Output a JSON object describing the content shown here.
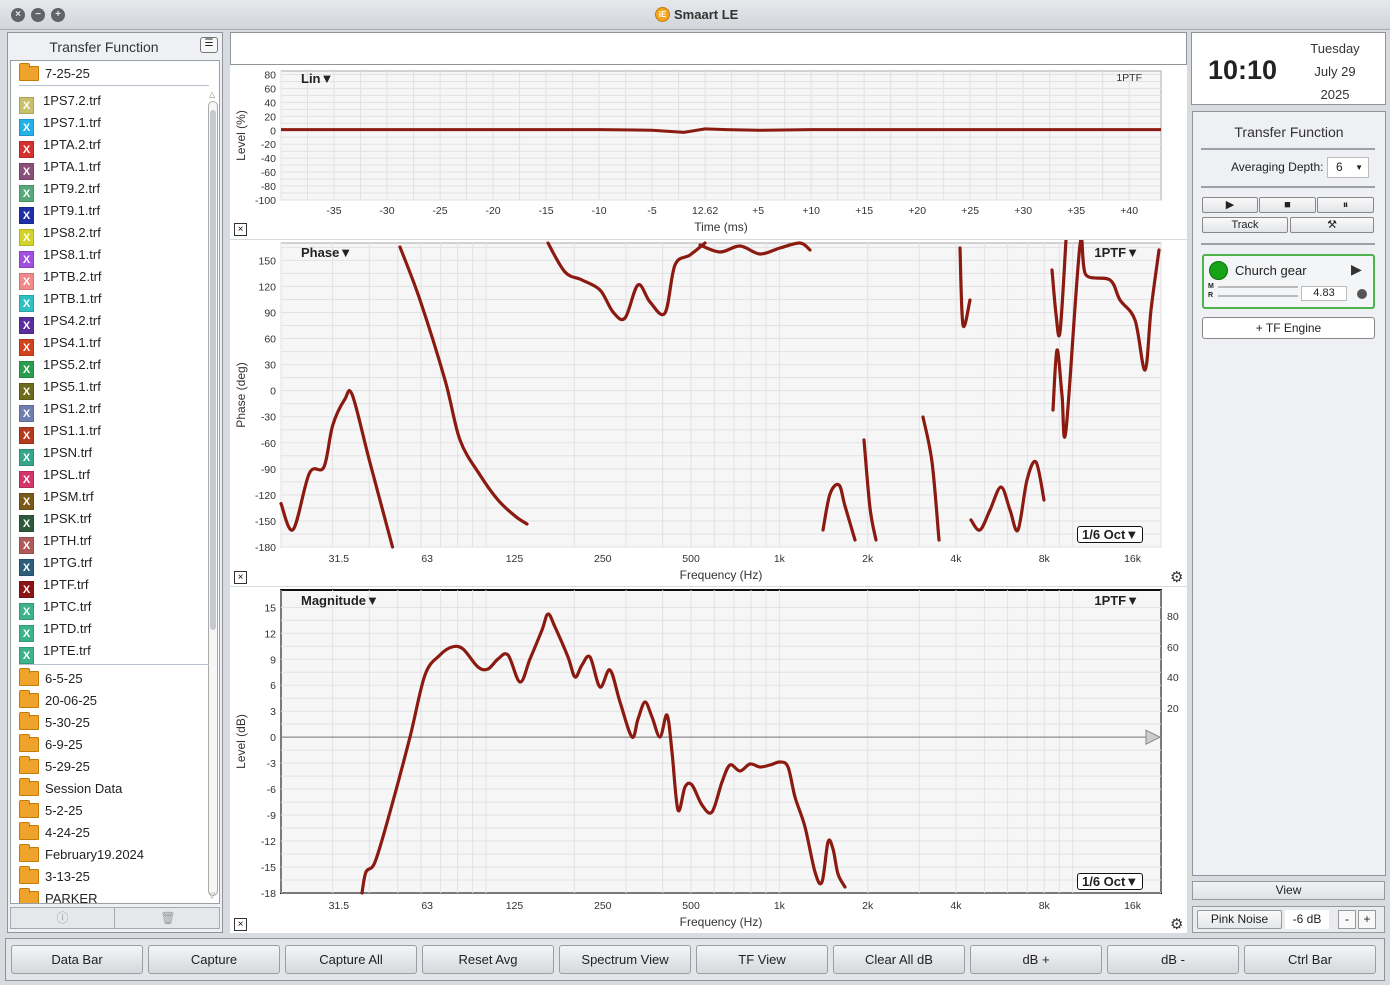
{
  "window": {
    "title": "Smaart LE",
    "logo_text": "iE"
  },
  "sidebar": {
    "title": "Transfer Function",
    "current_folder": "7-25-25",
    "files": [
      {
        "name": "1PS7.2.trf",
        "color": "#c8c06a"
      },
      {
        "name": "1PS7.1.trf",
        "color": "#23b1e8"
      },
      {
        "name": "1PTA.2.trf",
        "color": "#d63030"
      },
      {
        "name": "1PTA.1.trf",
        "color": "#8a4f7a"
      },
      {
        "name": "1PT9.2.trf",
        "color": "#56a97a"
      },
      {
        "name": "1PT9.1.trf",
        "color": "#1f2fa6"
      },
      {
        "name": "1PS8.2.trf",
        "color": "#d3d32a"
      },
      {
        "name": "1PS8.1.trf",
        "color": "#a24fe0"
      },
      {
        "name": "1PTB.2.trf",
        "color": "#f28a8a"
      },
      {
        "name": "1PTB.1.trf",
        "color": "#2fc1c1"
      },
      {
        "name": "1PS4.2.trf",
        "color": "#5a2e9c"
      },
      {
        "name": "1PS4.1.trf",
        "color": "#d2421c"
      },
      {
        "name": "1PS5.2.trf",
        "color": "#2a9e4e"
      },
      {
        "name": "1PS5.1.trf",
        "color": "#6e6b1a"
      },
      {
        "name": "1PS1.2.trf",
        "color": "#6f7fb0"
      },
      {
        "name": "1PS1.1.trf",
        "color": "#b33a1c"
      },
      {
        "name": "1PSN.trf",
        "color": "#36a58c"
      },
      {
        "name": "1PSL.trf",
        "color": "#d3346b"
      },
      {
        "name": "1PSM.trf",
        "color": "#7a5a1a"
      },
      {
        "name": "1PSK.trf",
        "color": "#2e5a3c"
      },
      {
        "name": "1PTH.trf",
        "color": "#b05a5a"
      },
      {
        "name": "1PTG.trf",
        "color": "#2b5f7c"
      },
      {
        "name": "1PTF.trf",
        "color": "#8c1414"
      },
      {
        "name": "1PTC.trf",
        "color": "#3cb389"
      },
      {
        "name": "1PTD.trf",
        "color": "#3cb389"
      },
      {
        "name": "1PTE.trf",
        "color": "#3cb389"
      }
    ],
    "folders": [
      "6-5-25",
      "20-06-25",
      "5-30-25",
      "6-9-25",
      "5-29-25",
      "Session Data",
      "5-2-25",
      "4-24-25",
      "February19.2024",
      "3-13-25",
      "PARKER"
    ],
    "footer_info": "ⓘ",
    "footer_trash": "🗑"
  },
  "clock": {
    "time": "10:10",
    "weekday": "Tuesday",
    "date": "July 29",
    "year": "2025"
  },
  "right_panel": {
    "title": "Transfer Function",
    "averaging_label": "Averaging Depth:",
    "averaging_value": "6",
    "play": "▶",
    "stop": "■",
    "pause": "⏸",
    "track": "Track",
    "tools": "⚒",
    "engine_name": "Church gear",
    "engine_m": "M",
    "engine_r": "R",
    "engine_value": "4.83",
    "add_engine": "+ TF Engine",
    "view": "View",
    "pink_noise": "Pink Noise",
    "noise_level": "-6 dB",
    "minus": "-",
    "plus": "+"
  },
  "plots": {
    "impulse": {
      "title": "Lin▼",
      "tag": "1PTF",
      "ylabel": "Level (%)",
      "xlabel": "Time (ms)",
      "yticks": [
        "80",
        "60",
        "40",
        "20",
        "0",
        "-20",
        "-40",
        "-60",
        "-80",
        "-100"
      ],
      "xticks": [
        "-35",
        "-30",
        "-25",
        "-20",
        "-15",
        "-10",
        "-5",
        "12.62",
        "+5",
        "+10",
        "+15",
        "+20",
        "+25",
        "+30",
        "+35",
        "+40"
      ]
    },
    "phase": {
      "title": "Phase▼",
      "tag": "1PTF▼",
      "ylabel": "Phase (deg)",
      "xlabel": "Frequency (Hz)",
      "yticks": [
        "150",
        "120",
        "90",
        "60",
        "30",
        "0",
        "-30",
        "-60",
        "-90",
        "-120",
        "-150",
        "-180"
      ],
      "xticks": [
        "31.5",
        "63",
        "125",
        "250",
        "500",
        "1k",
        "2k",
        "4k",
        "8k",
        "16k"
      ],
      "smoothing": "1/6 Oct▼"
    },
    "magnitude": {
      "title": "Magnitude▼",
      "tag": "1PTF▼",
      "ylabel": "Level (dB)",
      "xlabel": "Frequency (Hz)",
      "yticks": [
        "15",
        "12",
        "9",
        "6",
        "3",
        "0",
        "-3",
        "-6",
        "-9",
        "-12",
        "-15",
        "-18"
      ],
      "yticks_right": [
        "80",
        "60",
        "40",
        "20"
      ],
      "xticks": [
        "31.5",
        "63",
        "125",
        "250",
        "500",
        "1k",
        "2k",
        "4k",
        "8k",
        "16k"
      ],
      "smoothing": "1/6 Oct▼"
    }
  },
  "chart_data": [
    {
      "type": "line",
      "title": "Lin",
      "xlabel": "Time (ms)",
      "ylabel": "Level (%)",
      "xlim": [
        -40,
        43
      ],
      "ylim": [
        -100,
        85
      ],
      "series": [
        {
          "name": "1PTF",
          "x": [
            -40,
            -10,
            -5,
            -2,
            0,
            2,
            5,
            10,
            20,
            43
          ],
          "y": [
            1,
            1,
            0,
            -3,
            2,
            1,
            0,
            1,
            1,
            1
          ]
        }
      ]
    },
    {
      "type": "line",
      "title": "Phase",
      "xlabel": "Frequency (Hz)",
      "ylabel": "Phase (deg)",
      "xscale": "log",
      "xlim": [
        20,
        20000
      ],
      "ylim": [
        -180,
        170
      ],
      "series": [
        {
          "name": "1PTF",
          "x": [
            20,
            22,
            25,
            28,
            30,
            33,
            35,
            40,
            48
          ],
          "y": [
            -130,
            -160,
            -95,
            -88,
            -40,
            -10,
            -5,
            -80,
            -180
          ]
        }
      ]
    },
    {
      "type": "line",
      "title": "Magnitude",
      "xlabel": "Frequency (Hz)",
      "ylabel": "Level (dB)",
      "xscale": "log",
      "xlim": [
        20,
        20000
      ],
      "ylim": [
        -18,
        17
      ],
      "series": [
        {
          "name": "1PTF",
          "x": [
            40,
            50,
            63,
            80,
            100,
            125,
            160,
            200,
            250,
            315,
            400,
            500,
            630,
            800,
            1000,
            1250,
            1600
          ],
          "y": [
            -18,
            -9,
            8,
            11,
            8.5,
            7,
            15,
            7,
            6,
            0,
            4,
            -7,
            -3,
            -3,
            -6,
            -17,
            -18
          ]
        }
      ]
    }
  ],
  "toolbar": [
    "Data Bar",
    "Capture",
    "Capture All",
    "Reset Avg",
    "Spectrum View",
    "TF View",
    "Clear All dB",
    "dB +",
    "dB -",
    "Ctrl Bar"
  ]
}
